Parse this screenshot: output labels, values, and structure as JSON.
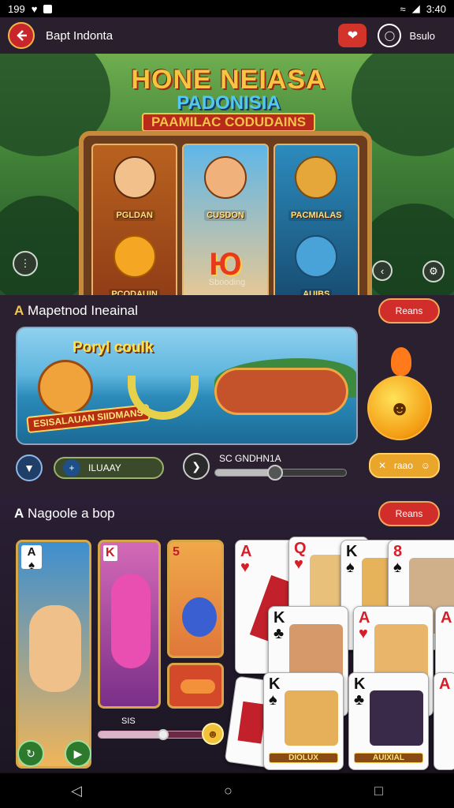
{
  "status": {
    "time": "199",
    "right_text": "3:40"
  },
  "header": {
    "title": "Bapt Indonta",
    "label": "Bsulo"
  },
  "hero": {
    "logo_line1": "HONE NEIASA",
    "logo_line2": "PADONISIA",
    "logo_line3": "PAAMILAC CODUDAINS",
    "reels": [
      {
        "top_label": "PGLDAN",
        "bottom_label": "PCODAUIN"
      },
      {
        "top_label": "CUSDON",
        "bottom_label": "Ю"
      },
      {
        "top_label": "PACMIALAS",
        "bottom_label": "AUIBS"
      }
    ],
    "footer": "Sbooding"
  },
  "section1": {
    "title_prefix": "A",
    "title": "Mapetnod Ineainal",
    "pill": "Reans",
    "game_title": "Poryl coulk",
    "badge": "ESISALAUAN SIIDMANS",
    "chip": "ILUAAY",
    "slider_label": "SC GNDHN1A",
    "slider_progress": 0.45,
    "emoji_button": "raao"
  },
  "section2": {
    "title_prefix": "A",
    "title": "Nagoole a bop",
    "pill": "Reans",
    "slider_label": "SIS",
    "slider_progress": 0.6,
    "card_labels": [
      "DIOLUX",
      "AUIXIAL"
    ]
  },
  "nav": {
    "back": "◁",
    "home": "○",
    "recent": "□"
  }
}
